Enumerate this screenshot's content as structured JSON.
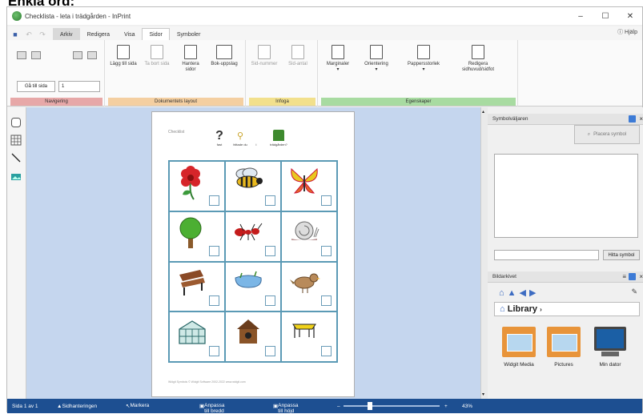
{
  "heading": "Enkla ord:",
  "window": {
    "title": "Checklista - leta i trädgården - InPrint"
  },
  "tabs": [
    {
      "label": "Arkiv"
    },
    {
      "label": "Redigera"
    },
    {
      "label": "Visa"
    },
    {
      "label": "Sidor"
    },
    {
      "label": "Symboler"
    }
  ],
  "help_label": "Hjälp",
  "ribbon": {
    "groups": [
      {
        "label": "Navigering",
        "color": "#e7a8a8"
      },
      {
        "label": "Dokumentets layout",
        "color": "#f4cfa1"
      },
      {
        "label": "Infoga",
        "color": "#f2e08c"
      },
      {
        "label": "Egenskaper",
        "color": "#a8dba1"
      }
    ],
    "nav_button": "Gå till sida",
    "page_value": "1",
    "buttons": {
      "add_page": "Lägg till sida",
      "remove_page": "Ta bort sida",
      "manage_pages": "Hantera sidor",
      "spread": "Bok-uppslag",
      "page_number": "Sid-nummer",
      "page_count": "Sid-antal",
      "margins": "Marginaler",
      "orientation": "Orientering",
      "paper_size": "Pappersstorlek",
      "edit_header": "Redigera sidhuvud/sidfot"
    }
  },
  "document": {
    "page_header": "Checklist",
    "header_icons": [
      {
        "label": "fast"
      },
      {
        "label": "hittade du"
      },
      {
        "label": "i"
      },
      {
        "label": "trädgården?"
      }
    ],
    "cells": [
      {
        "icon": "flower-icon"
      },
      {
        "icon": "bee-icon"
      },
      {
        "icon": "butterfly-icon"
      },
      {
        "icon": "tree-icon"
      },
      {
        "icon": "ant-icon"
      },
      {
        "icon": "snail-icon"
      },
      {
        "icon": "bench-icon"
      },
      {
        "icon": "pond-icon"
      },
      {
        "icon": "bird-icon"
      },
      {
        "icon": "greenhouse-icon"
      },
      {
        "icon": "birdhouse-icon"
      },
      {
        "icon": "trampoline-icon"
      }
    ],
    "footer": "Widgit Symbols © Widgit Software 2002-2022 www.widgit.com"
  },
  "symbol_panel": {
    "title": "Symbolväljaren",
    "button": "Placera symbol",
    "find_button": "Hitta symbol"
  },
  "library_panel": {
    "title": "Bildarkivet",
    "library_label": "Library",
    "items": [
      {
        "label": "Widgit Media"
      },
      {
        "label": "Pictures"
      },
      {
        "label": "Min dator"
      }
    ]
  },
  "statusbar": {
    "page_info": "Sida 1 av 1",
    "page_mgmt": "Sidhanteringen",
    "select": "Markera",
    "fit_width": "Anpassa till bredd",
    "fit_height": "Anpassa till höjd",
    "zoom": "43%"
  }
}
